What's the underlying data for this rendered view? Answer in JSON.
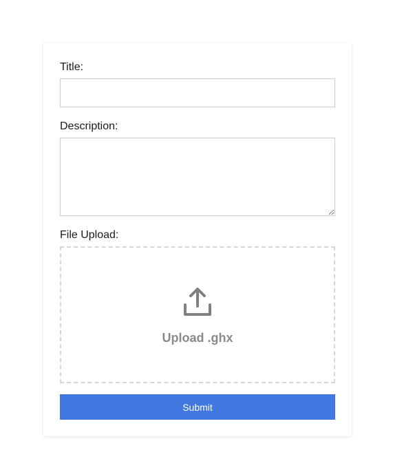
{
  "form": {
    "title_label": "Title:",
    "title_value": "",
    "description_label": "Description:",
    "description_value": "",
    "file_label": "File Upload:",
    "upload_text": "Upload .ghx",
    "submit_label": "Submit"
  },
  "icons": {
    "upload": "upload-icon"
  },
  "colors": {
    "submit_bg": "#4078e0",
    "upload_text": "#8a8a8a",
    "dropzone_border": "#d5d5d5"
  }
}
